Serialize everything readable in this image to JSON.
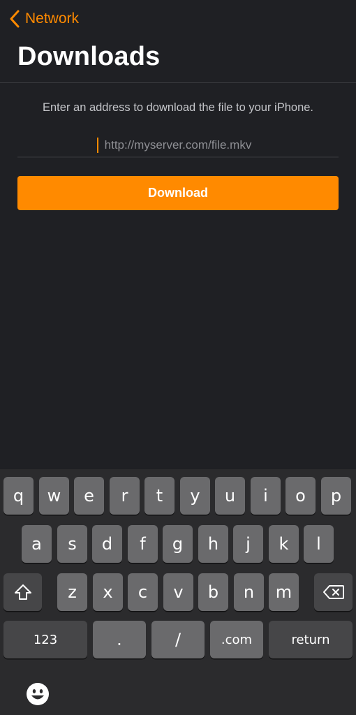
{
  "nav": {
    "back_label": "Network",
    "accent_color": "#ff8a00"
  },
  "page": {
    "title": "Downloads",
    "instructions": "Enter an address to download the file to your iPhone."
  },
  "url_field": {
    "value": "",
    "placeholder": "http://myserver.com/file.mkv"
  },
  "download_button": {
    "label": "Download"
  },
  "keyboard": {
    "row1": [
      "q",
      "w",
      "e",
      "r",
      "t",
      "y",
      "u",
      "i",
      "o",
      "p"
    ],
    "row2": [
      "a",
      "s",
      "d",
      "f",
      "g",
      "h",
      "j",
      "k",
      "l"
    ],
    "row3": [
      "z",
      "x",
      "c",
      "v",
      "b",
      "n",
      "m"
    ],
    "row4": {
      "numbers": "123",
      "period": ".",
      "slash": "/",
      "dotcom": ".com",
      "return": "return"
    },
    "icons": {
      "shift": "shift-icon",
      "delete": "delete-backspace-icon",
      "emoji": "emoji-icon"
    }
  }
}
